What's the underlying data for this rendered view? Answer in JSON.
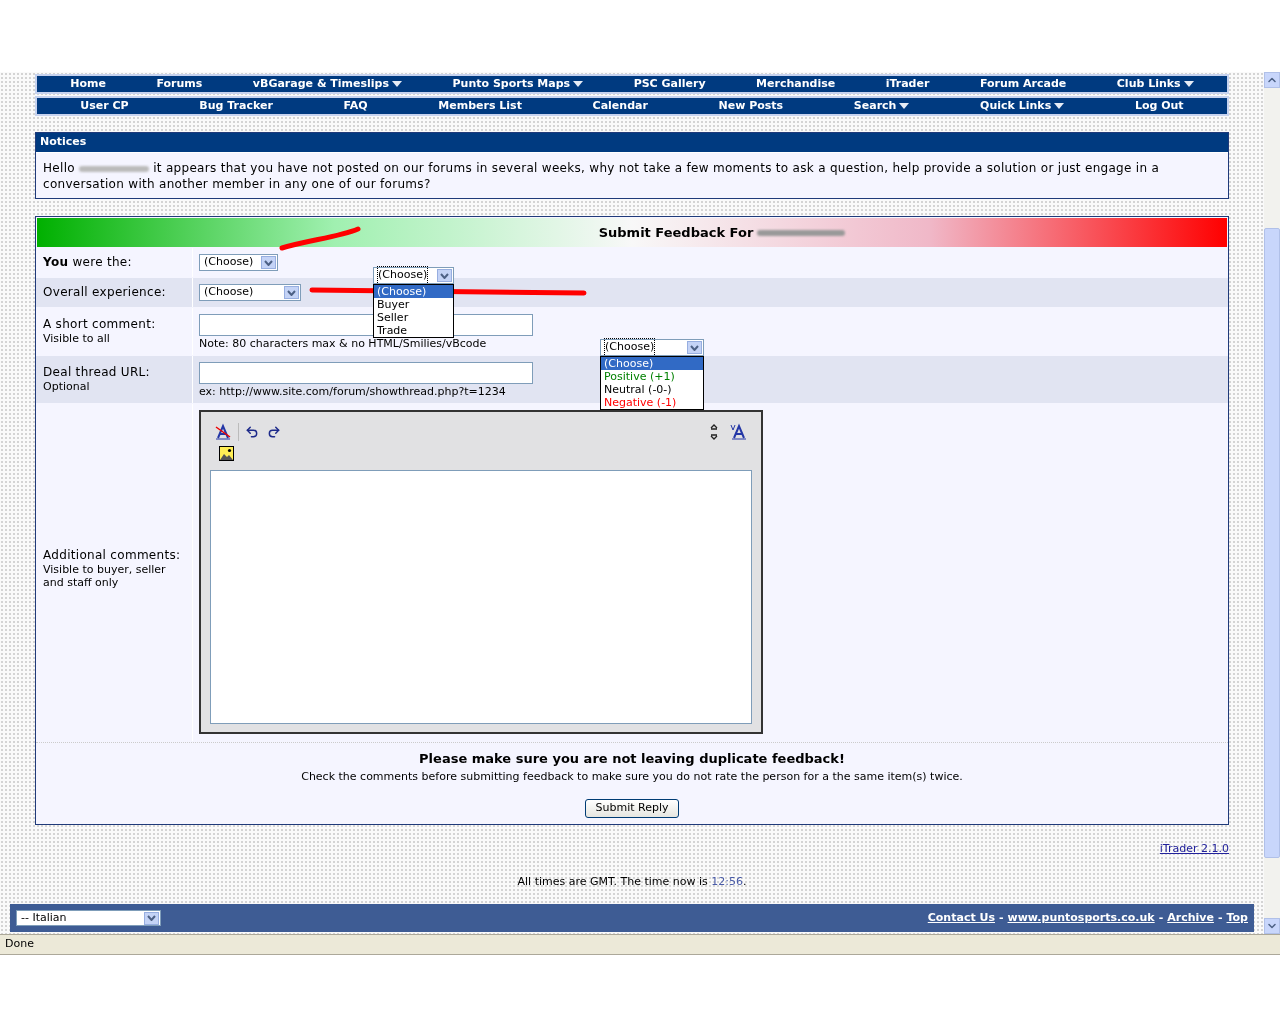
{
  "nav_rows": [
    [
      {
        "label": "Home",
        "menu": false
      },
      {
        "label": "Forums",
        "menu": false
      },
      {
        "label": "vBGarage & Timeslips",
        "menu": true
      },
      {
        "label": "Punto Sports Maps",
        "menu": true
      },
      {
        "label": "PSC Gallery",
        "menu": false
      },
      {
        "label": "Merchandise",
        "menu": false
      },
      {
        "label": "iTrader",
        "menu": false
      },
      {
        "label": "Forum Arcade",
        "menu": false
      },
      {
        "label": "Club Links",
        "menu": true
      }
    ],
    [
      {
        "label": "User CP",
        "menu": false
      },
      {
        "label": "Bug Tracker",
        "menu": false
      },
      {
        "label": "FAQ",
        "menu": false
      },
      {
        "label": "Members List",
        "menu": false
      },
      {
        "label": "Calendar",
        "menu": false
      },
      {
        "label": "New Posts",
        "menu": false
      },
      {
        "label": "Search",
        "menu": true
      },
      {
        "label": "Quick Links",
        "menu": true
      },
      {
        "label": "Log Out",
        "menu": false
      }
    ]
  ],
  "notices": {
    "title": "Notices",
    "greeting": "Hello",
    "text": "it appears that you have not posted on our forums in several weeks, why not take a few moments to ask a question, help provide a solution or just engage in a conversation with another member in any one of our forums?"
  },
  "feedback": {
    "title": "Submit Feedback For",
    "rows": [
      {
        "kind": "select",
        "label": "**You** were the:",
        "value": "(Choose)"
      },
      {
        "kind": "select",
        "label": "Overall experience:",
        "value": "(Choose)",
        "wide": true
      },
      {
        "kind": "text",
        "label": "A short comment:",
        "sublabel": "Visible to all",
        "note": "Note: 80 characters max & no HTML/Smilies/vBcode"
      },
      {
        "kind": "text",
        "label": "Deal thread URL:",
        "sublabel": "Optional",
        "note": "ex: http://www.site.com/forum/showthread.php?t=1234"
      },
      {
        "kind": "editor",
        "label": "Additional comments:",
        "sublabel": "Visible to buyer, seller and staff only"
      }
    ],
    "warning_title": "Please make sure you are not leaving duplicate feedback!",
    "warning_text": "Check the comments before submitting feedback to make sure you do not rate the person for a the same item(s) twice.",
    "submit": "Submit Reply"
  },
  "open_dropdowns": [
    {
      "value": "(Choose)",
      "options": [
        {
          "label": "(Choose)",
          "selected": true
        },
        {
          "label": "Buyer",
          "selected": false
        },
        {
          "label": "Seller",
          "selected": false
        },
        {
          "label": "Trade",
          "selected": false
        }
      ]
    },
    {
      "value": "(Choose)",
      "options": [
        {
          "label": "(Choose)",
          "selected": true
        },
        {
          "label": "Positive (+1)",
          "selected": false,
          "color": "#008000"
        },
        {
          "label": "Neutral (-0-)",
          "selected": false,
          "color": "#000000"
        },
        {
          "label": "Negative (-1)",
          "selected": false,
          "color": "#ff0000"
        }
      ]
    }
  ],
  "version_link": "iTrader 2.1.0",
  "time_prefix": "All times are GMT. The time now is",
  "time": "12:56",
  "time_suffix": ".",
  "language": "-- Italian",
  "footer_links": [
    "Contact Us",
    "www.puntosports.co.uk",
    "Archive",
    "Top"
  ],
  "footer_separator": "-",
  "status": "Done"
}
